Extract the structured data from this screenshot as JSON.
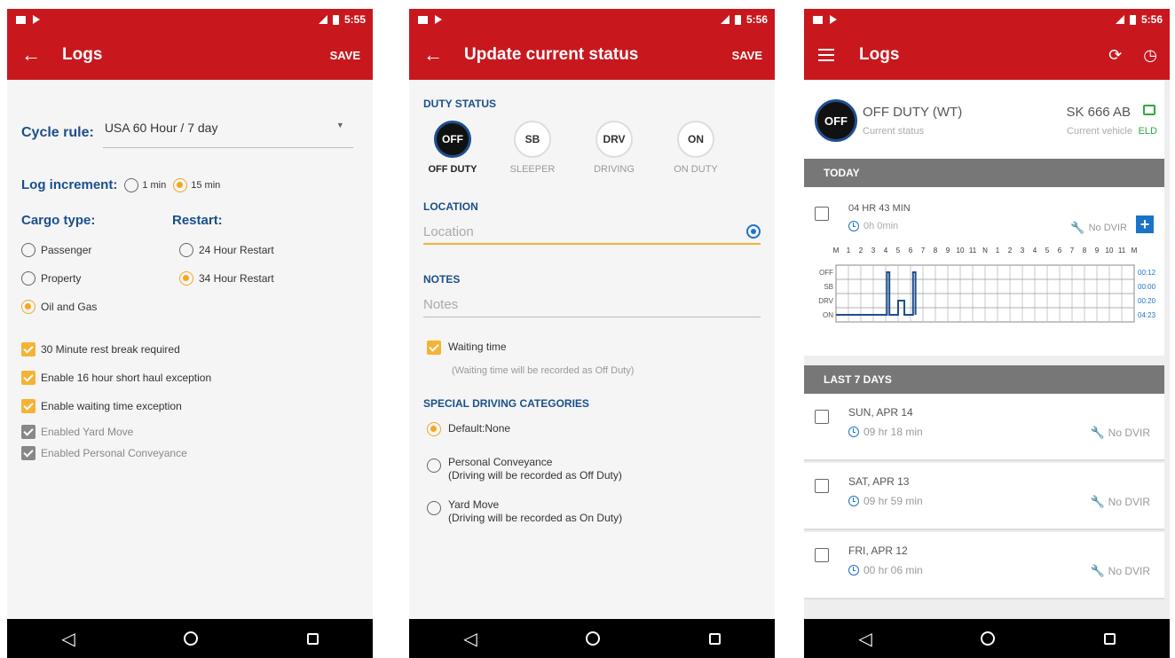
{
  "status_bar": {
    "p1_time": "5:55",
    "p2_time": "5:56",
    "p3_time": "5:56"
  },
  "panel1": {
    "title": "Logs",
    "save_label": "SAVE",
    "cycle_rule_label": "Cycle rule:",
    "cycle_rule_value": "USA 60 Hour / 7 day",
    "log_increment_label": "Log increment:",
    "inc_1min": "1 min",
    "inc_15min": "15 min",
    "cargo_label": "Cargo type:",
    "cargo_passenger": "Passenger",
    "cargo_property": "Property",
    "cargo_oil": "Oil and Gas",
    "restart_label": "Restart:",
    "restart_24": "24 Hour Restart",
    "restart_34": "34 Hour Restart",
    "chk_rest": "30 Minute rest break required",
    "chk_16hr": "Enable 16 hour short haul exception",
    "chk_waiting": "Enable waiting time exception",
    "chk_yard": "Enabled Yard Move",
    "chk_personal": "Enabled Personal Conveyance"
  },
  "panel2": {
    "title": "Update current status",
    "save_label": "SAVE",
    "duty_status_header": "DUTY STATUS",
    "duty": [
      {
        "code": "OFF",
        "label": "OFF DUTY"
      },
      {
        "code": "SB",
        "label": "SLEEPER"
      },
      {
        "code": "DRV",
        "label": "DRIVING"
      },
      {
        "code": "ON",
        "label": "ON DUTY"
      }
    ],
    "location_header": "LOCATION",
    "location_placeholder": "Location",
    "notes_header": "NOTES",
    "notes_placeholder": "Notes",
    "waiting_time": "Waiting time",
    "waiting_note": "(Waiting time will be recorded as Off Duty)",
    "special_header": "SPECIAL DRIVING CATEGORIES",
    "cat_default": "Default:None",
    "cat_personal": "Personal Conveyance",
    "cat_personal_note": "(Driving will be recorded as Off Duty)",
    "cat_yard": "Yard Move",
    "cat_yard_note": "(Driving will be recorded as On Duty)"
  },
  "panel3": {
    "title": "Logs",
    "current_code": "OFF",
    "current_status": "OFF DUTY (WT)",
    "current_status_sub": "Current status",
    "vehicle": "SK 666 AB",
    "vehicle_sub": "Current vehicle",
    "eld_label": "ELD",
    "today_header": "TODAY",
    "today_hours": "04 HR  43 MIN",
    "today_duration": "0h 0min",
    "no_dvir": "No DVIR",
    "grid_row_labels": [
      "OFF",
      "SB",
      "DRV",
      "ON"
    ],
    "grid_totals": [
      "00:12",
      "00:00",
      "00:20",
      "04:23"
    ],
    "grid_hour_labels": [
      "M",
      "1",
      "2",
      "3",
      "4",
      "5",
      "6",
      "7",
      "8",
      "9",
      "10",
      "11",
      "N",
      "1",
      "2",
      "3",
      "4",
      "5",
      "6",
      "7",
      "8",
      "9",
      "10",
      "11",
      "M"
    ],
    "last7_header": "LAST 7 DAYS",
    "days": [
      {
        "day": "SUN, APR 14",
        "duration": "09 hr  18 min",
        "dvir": "No DVIR"
      },
      {
        "day": "SAT, APR 13",
        "duration": "09 hr  59 min",
        "dvir": "No DVIR"
      },
      {
        "day": "FRI, APR 12",
        "duration": "00 hr  06 min",
        "dvir": "No DVIR"
      }
    ]
  },
  "colors": {
    "brand_red": "#c8181e",
    "accent_yellow": "#f5b335",
    "label_blue": "#1b4f8a",
    "icon_blue": "#1b73c9",
    "eld_green": "#2eaa3c"
  }
}
